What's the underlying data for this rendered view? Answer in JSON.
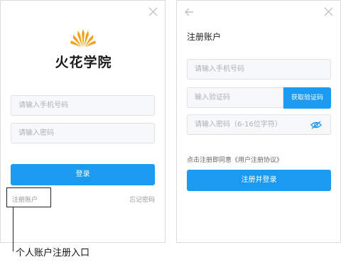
{
  "login": {
    "brand": "火花学院",
    "phone_placeholder": "请输入手机号码",
    "password_placeholder": "请输入密码",
    "login_label": "登录",
    "register_link": "注册账户",
    "forgot_link": "忘记密码"
  },
  "annotation": {
    "caption": "个人账户注册入口"
  },
  "register": {
    "title": "注册账户",
    "phone_placeholder": "请输入手机号码",
    "code_placeholder": "输入验证码",
    "send_code_label": "获取验证码",
    "password_placeholder": "请输入密码（6-16位字符）",
    "agreement": "点击注册即同意《用户注册协议》",
    "submit_label": "注册并登录"
  },
  "colors": {
    "accent": "#1a9bf0",
    "logo": "#f0a21a"
  },
  "icons": [
    "close-icon",
    "back-icon",
    "eye-off-icon",
    "logo-icon"
  ]
}
